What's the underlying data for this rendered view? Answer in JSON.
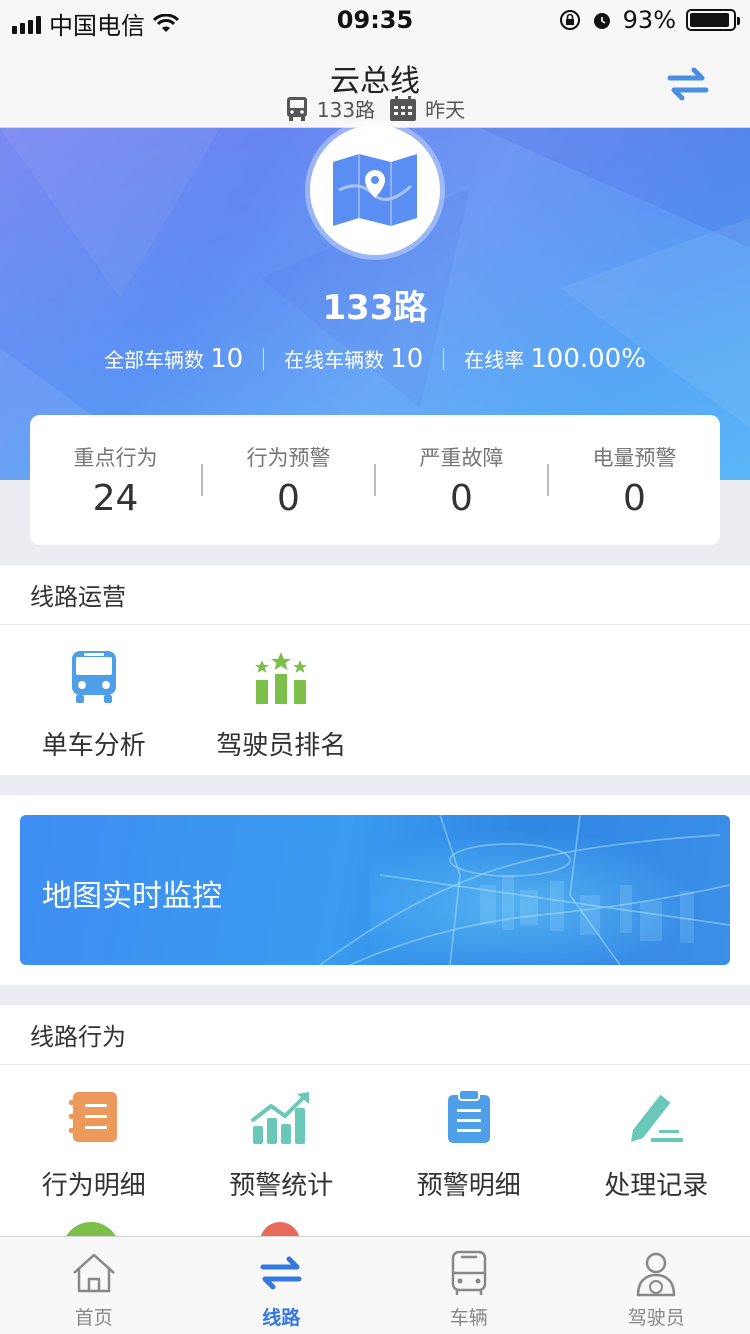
{
  "status_bar": {
    "carrier": "中国电信",
    "time": "09:35",
    "battery": "93%",
    "battery_level": 0.93
  },
  "nav": {
    "title": "云总线",
    "route": "133路",
    "date": "昨天"
  },
  "hero": {
    "route_name": "133路",
    "stats": [
      {
        "label": "全部车辆数",
        "value": "10"
      },
      {
        "label": "在线车辆数",
        "value": "10"
      },
      {
        "label": "在线率",
        "value": "100.00%"
      }
    ]
  },
  "summary": [
    {
      "label": "重点行为",
      "value": "24"
    },
    {
      "label": "行为预警",
      "value": "0"
    },
    {
      "label": "严重故障",
      "value": "0"
    },
    {
      "label": "电量预警",
      "value": "0"
    }
  ],
  "operations": {
    "title": "线路运营",
    "items": [
      {
        "label": "单车分析",
        "icon": "bus-icon"
      },
      {
        "label": "驾驶员排名",
        "icon": "ranking-icon"
      }
    ]
  },
  "banner": {
    "label": "地图实时监控"
  },
  "behavior": {
    "title": "线路行为",
    "items": [
      {
        "label": "行为明细",
        "icon": "notebook-icon"
      },
      {
        "label": "预警统计",
        "icon": "bar-chart-icon"
      },
      {
        "label": "预警明细",
        "icon": "clipboard-icon"
      },
      {
        "label": "处理记录",
        "icon": "pencil-icon"
      }
    ]
  },
  "tabbar": [
    {
      "label": "首页",
      "icon": "home-icon"
    },
    {
      "label": "线路",
      "icon": "swap-icon"
    },
    {
      "label": "车辆",
      "icon": "bus-icon"
    },
    {
      "label": "驾驶员",
      "icon": "driver-icon"
    }
  ],
  "colors": {
    "accent": "#3478e0",
    "hero_start": "#6f7ff0",
    "hero_end": "#5ab6f6",
    "orange": "#ec9a5c",
    "green": "#7cbf4b",
    "teal": "#6ac8b9",
    "blue": "#4e9fe8"
  }
}
